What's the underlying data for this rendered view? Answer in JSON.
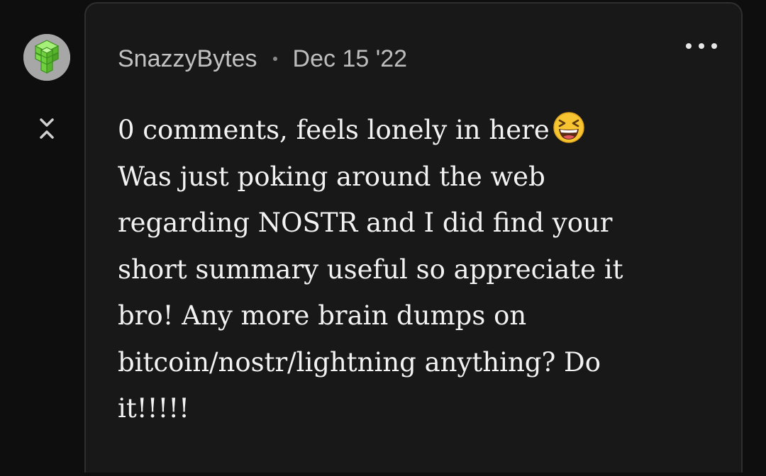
{
  "comment": {
    "author": "SnazzyBytes",
    "separator": "·",
    "date": "Dec 15 '22",
    "body_lines": [
      "0 comments, feels lonely in here",
      "Was just poking around the web",
      "regarding NOSTR and I did find your",
      "short summary useful so appreciate it",
      "bro! Any more brain dumps on",
      "bitcoin/nostr/lightning anything? Do",
      "it!!!!!"
    ],
    "emoji": "laughing-squinting-face-emoji"
  },
  "icons": {
    "avatar": "green-cubes-avatar",
    "collapse": "collapse-thread-icon",
    "more": "more-options-icon"
  },
  "colors": {
    "background": "#0e0e0e",
    "card": "#181818",
    "text": "#f2f2f2",
    "meta": "#bdbdbd",
    "avatar_green": "#7ed957"
  }
}
